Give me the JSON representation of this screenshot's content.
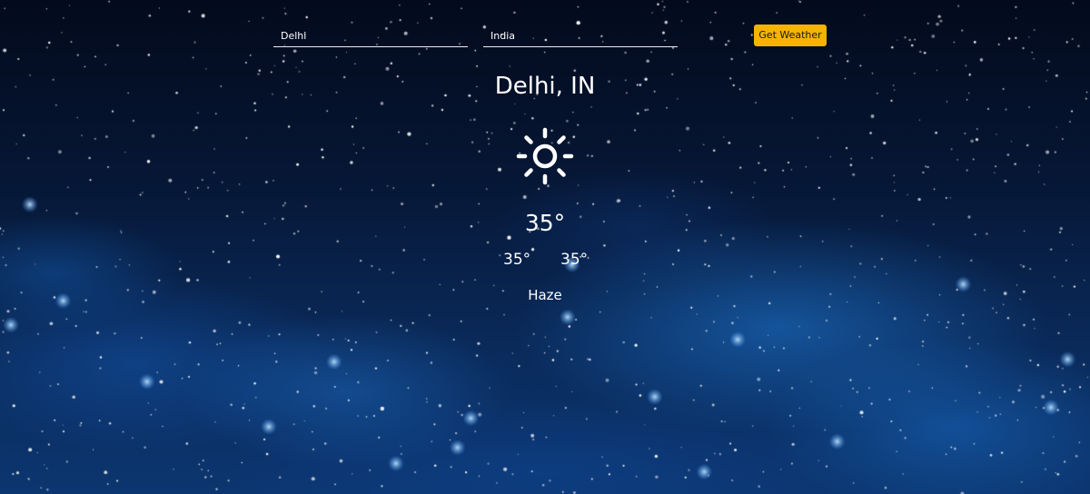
{
  "search": {
    "city_value": "Delhi",
    "country_value": "India",
    "button_label": "Get Weather"
  },
  "weather": {
    "location": "Delhi, IN",
    "icon": "sun-icon",
    "temperature": "35°",
    "temp_min": "35°",
    "temp_max": "35°",
    "description": "Haze"
  },
  "colors": {
    "button_bg": "#f4b400",
    "text": "#ffffff",
    "sky_dark": "#030a1c",
    "nebula_blue": "#1e78d2"
  }
}
